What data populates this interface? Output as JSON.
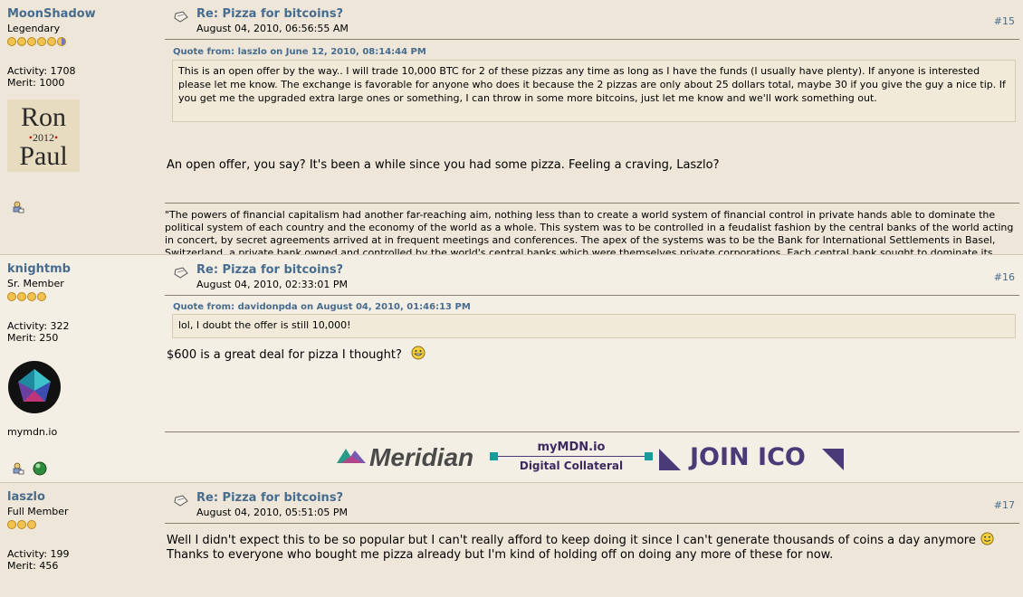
{
  "posts": [
    {
      "username": "MoonShadow",
      "rank": "Legendary",
      "activity": "Activity: 1708",
      "merit": "Merit: 1000",
      "avatar_line1": "Ron",
      "avatar_year": "2012",
      "avatar_line2": "Paul",
      "title": "Re: Pizza for bitcoins?",
      "date": "August 04, 2010, 06:56:55 AM",
      "number": "#15",
      "quote_header": "Quote from: laszlo on June 12, 2010, 08:14:44 PM",
      "quote_text": "This is an open offer by the way.. I will trade 10,000 BTC for 2 of these pizzas any time as long as I have the funds (I usually have plenty).  If anyone is interested please let me know.  The exchange is favorable for anyone who does it because the 2 pizzas are only about 25 dollars total, maybe 30 if you give the guy a nice tip.  If you get me the upgraded extra large ones or something, I can throw in some more bitcoins, just let me know and we'll work something out.",
      "body": "An open offer, you say?  It's been a while since you had some pizza.  Feeling a craving, Laszlo?",
      "signature": "\"The powers of financial capitalism had another far-reaching aim, nothing less than to create a world system of financial control in private hands able to dominate the political system of each country and the economy of the world as a whole. This system was to be controlled in a feudalist fashion by the central banks of the world acting in concert, by secret agreements arrived at in frequent meetings and conferences. The apex of the systems was to be the Bank for International Settlements in Basel, Switzerland, a private bank owned and controlled by the world's central banks which were themselves private corporations. Each central bank sought to dominate its"
    },
    {
      "username": "knightmb",
      "rank": "Sr. Member",
      "activity": "Activity: 322",
      "merit": "Merit: 250",
      "website": "mymdn.io",
      "title": "Re: Pizza for bitcoins?",
      "date": "August 04, 2010, 02:33:01 PM",
      "number": "#16",
      "quote_header": "Quote from: davidonpda on August 04, 2010, 01:46:13 PM",
      "quote_text": "lol, I doubt the offer is still 10,000!",
      "body": "$600 is a great deal for pizza I thought?",
      "banner_meridian": "Meridian",
      "banner_mymdn": "myMDN.io",
      "banner_collateral": "Digital Collateral",
      "banner_join": "JOIN ICO"
    },
    {
      "username": "laszlo",
      "rank": "Full Member",
      "activity": "Activity: 199",
      "merit": "Merit: 456",
      "title": "Re: Pizza for bitcoins?",
      "date": "August 04, 2010, 05:51:05 PM",
      "number": "#17",
      "body_line1": "Well I didn't expect this to be so popular but I can't really afford to keep doing it since I can't generate thousands of coins a day anymore",
      "body_line2": "Thanks to everyone who bought me pizza already but I'm kind of holding off on doing any more of these for now."
    }
  ],
  "colors": {
    "link": "#476c8e",
    "star": "#f2c14e",
    "banner_purple": "#4a3a78",
    "banner_teal": "#1a9a9a"
  }
}
